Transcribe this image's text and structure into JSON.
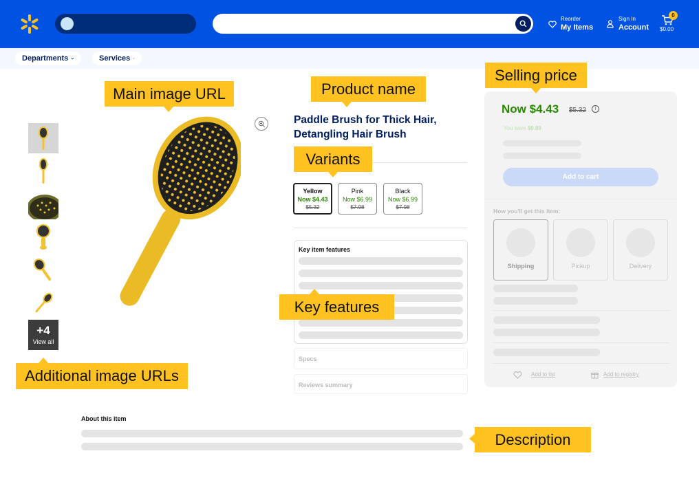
{
  "header": {
    "reorder_small": "Reorder",
    "reorder_big": "My Items",
    "signin_small": "Sign In",
    "signin_big": "Account",
    "cart_count": "0",
    "cart_total": "$0.00"
  },
  "subnav": {
    "departments": "Departments",
    "services": "Services"
  },
  "callouts": {
    "main_image": "Main image URL",
    "product_name": "Product name",
    "selling_price": "Selling price",
    "variants": "Variants",
    "key_features": "Key features",
    "additional_images": "Additional image URLs",
    "description": "Description"
  },
  "thumbs": {
    "more_count": "+4",
    "view_all": "View all"
  },
  "product": {
    "title_line1": "Paddle Brush for Thick Hair,",
    "title_line2": "Detangling Hair Brush",
    "variants": [
      {
        "name": "Yellow",
        "price": "Now $4.43",
        "old": "$5.32"
      },
      {
        "name": "Pink",
        "price": "Now $6.99",
        "old": "$7.98"
      },
      {
        "name": "Black",
        "price": "Now $6.99",
        "old": "$7.98"
      }
    ],
    "key_features_label": "Key item features",
    "specs_label": "Specs",
    "reviews_label": "Reviews summary"
  },
  "buybox": {
    "price": "Now $4.43",
    "old_price": "$5.32",
    "you_save_label": "You save",
    "you_save_value": "$0.89",
    "add_to_cart": "Add to cart",
    "how_get": "How you'll get this item:",
    "shipping": "Shipping",
    "pickup": "Pickup",
    "delivery": "Delivery",
    "add_to_list": "Add to list",
    "add_to_registry": "Add to registry"
  },
  "about": {
    "label": "About this item"
  },
  "colors": {
    "brand_blue": "#0053e2",
    "callout_yellow": "#ffc220",
    "price_green": "#2a8703",
    "navy": "#001e60"
  }
}
